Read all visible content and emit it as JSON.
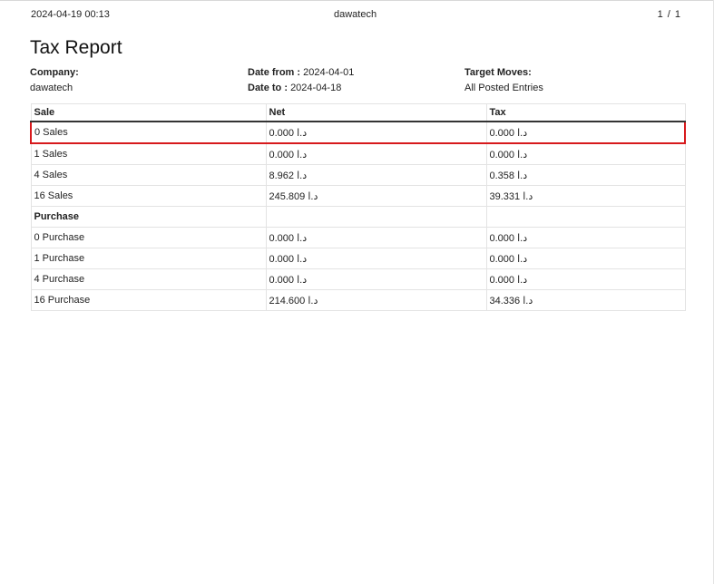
{
  "header": {
    "datetime": "2024-04-19 00:13",
    "company": "dawatech",
    "page_indicator": "1 / 1"
  },
  "report": {
    "title": "Tax Report",
    "company_label": "Company:",
    "company_value": "dawatech",
    "date_from_label": "Date from :",
    "date_from_value": "2024-04-01",
    "date_to_label": "Date to :",
    "date_to_value": "2024-04-18",
    "target_moves_label": "Target Moves:",
    "target_moves_value": "All Posted Entries"
  },
  "table": {
    "columns": [
      "Sale",
      "Net",
      "Tax"
    ],
    "rows": [
      {
        "name": "0 Sales",
        "net": "0.000 د.ا",
        "tax": "0.000 د.ا"
      },
      {
        "name": "1 Sales",
        "net": "0.000 د.ا",
        "tax": "0.000 د.ا"
      },
      {
        "name": "4 Sales",
        "net": "8.962 د.ا",
        "tax": "0.358 د.ا"
      },
      {
        "name": "16 Sales",
        "net": "245.809 د.ا",
        "tax": "39.331 د.ا"
      },
      {
        "name": "Purchase",
        "net": "",
        "tax": ""
      },
      {
        "name": "0 Purchase",
        "net": "0.000 د.ا",
        "tax": "0.000 د.ا"
      },
      {
        "name": "1 Purchase",
        "net": "0.000 د.ا",
        "tax": "0.000 د.ا"
      },
      {
        "name": "4 Purchase",
        "net": "0.000 د.ا",
        "tax": "0.000 د.ا"
      },
      {
        "name": "16 Purchase",
        "net": "214.600 د.ا",
        "tax": "34.336 د.ا"
      }
    ]
  },
  "colors": {
    "highlight": "#d7191c",
    "border": "#e3e3e3",
    "header_rule": "#333333"
  }
}
